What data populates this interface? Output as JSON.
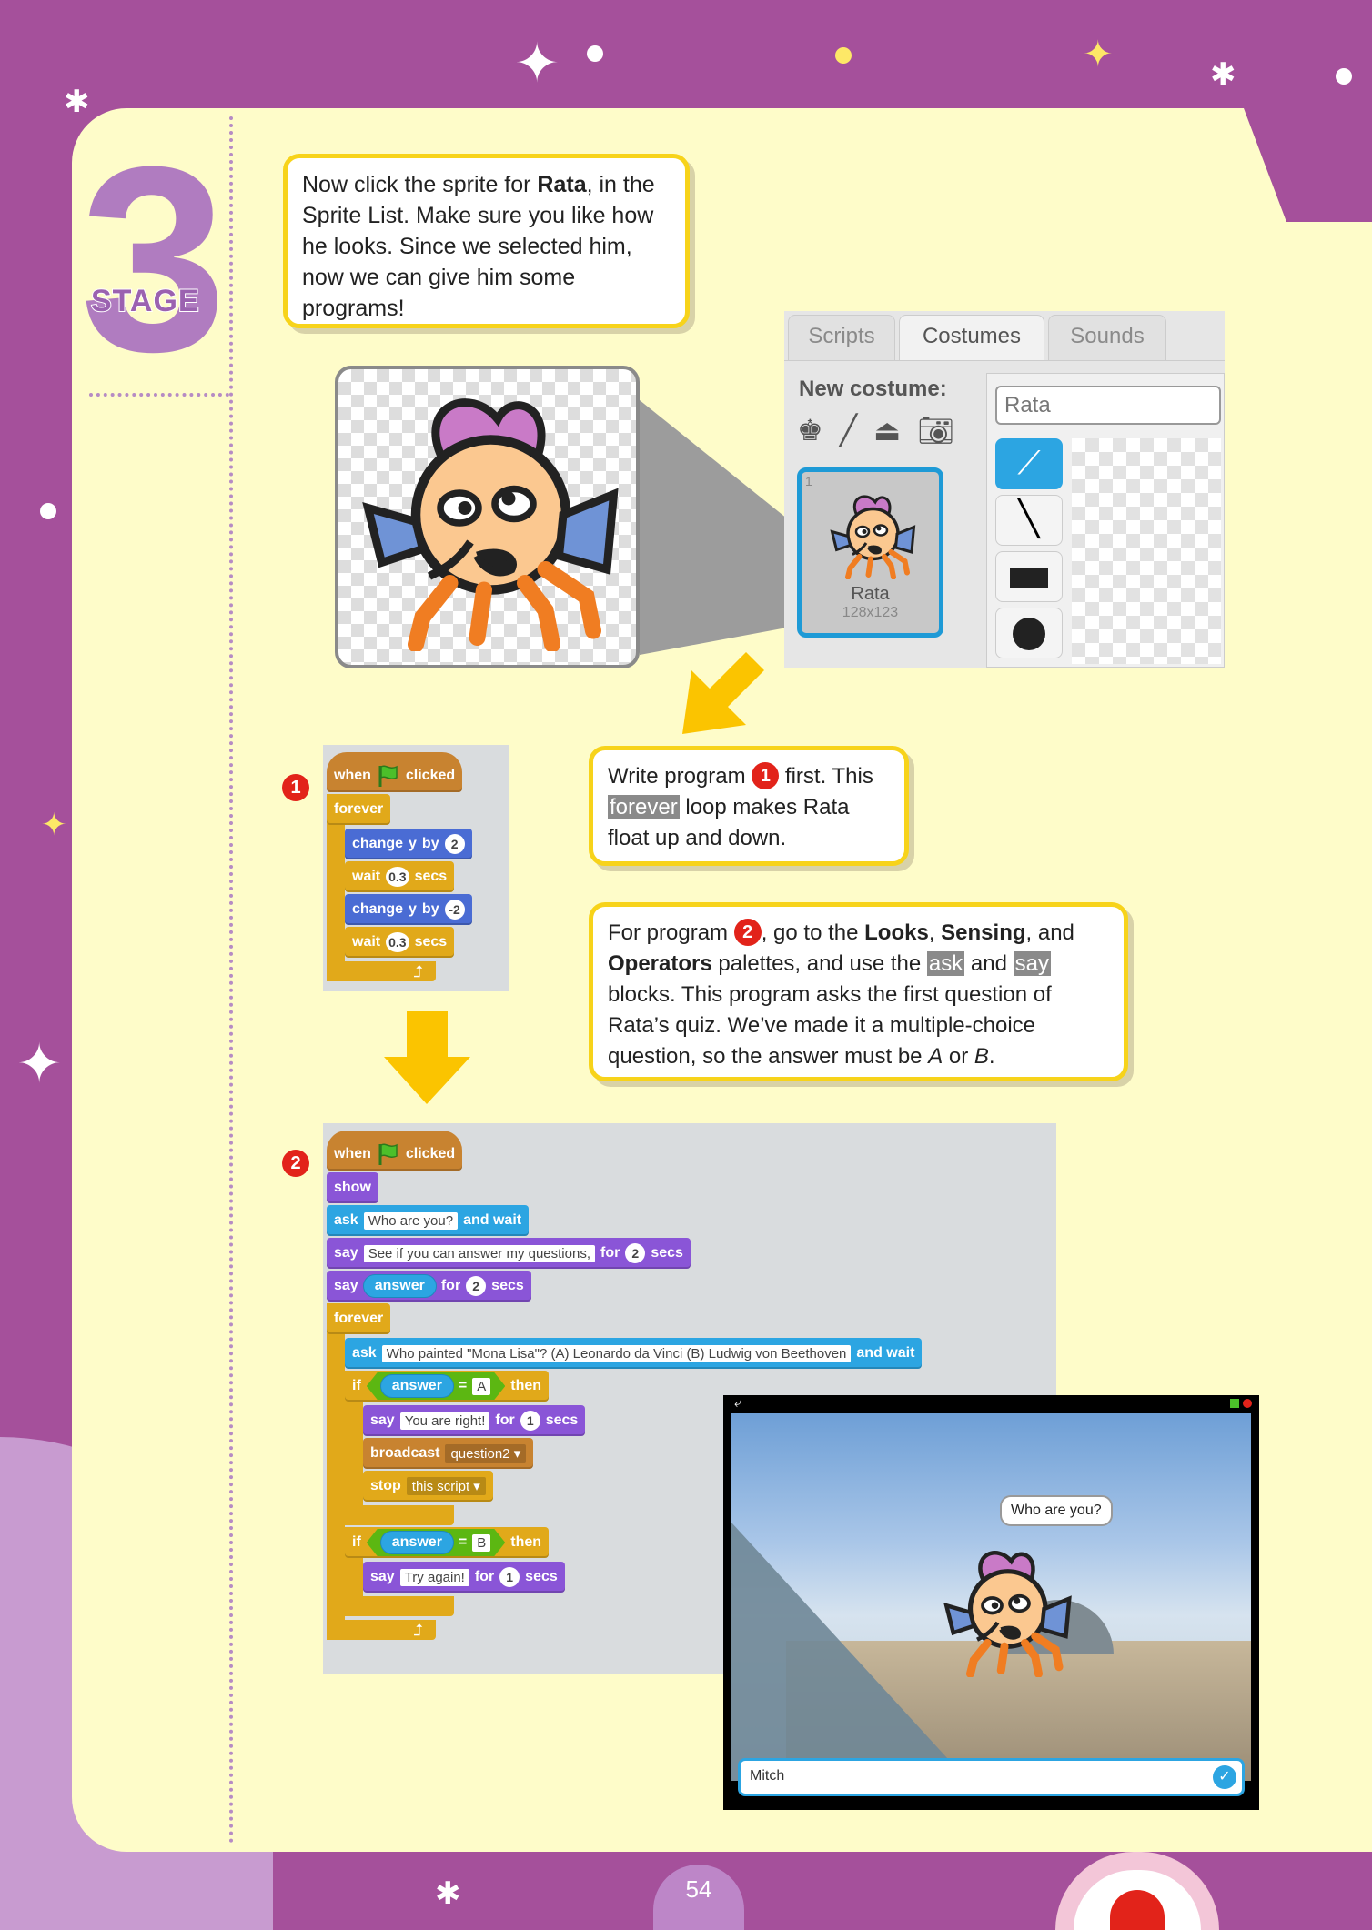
{
  "page": {
    "stage_number": "3",
    "stage_word": "STAGE",
    "page_number": "54"
  },
  "colors": {
    "page_bg": "#a5509b",
    "panel": "#fefcc9",
    "callout_border": "#f7d31a",
    "badge": "#e2231a",
    "events": "#c88330",
    "control": "#e1a91a",
    "motion": "#4a6cd4",
    "looks": "#8a55d7",
    "sensing": "#2ca5e2",
    "operators": "#5cb712"
  },
  "callout1": {
    "p1": "Now click the sprite for ",
    "b1": "Rata",
    "p2": ", in the Sprite List. Make sure you like how he looks. Since we selected him, now we can give him some programs!"
  },
  "callout2": {
    "p1": "Write program ",
    "badge": "1",
    "p2": " first. This ",
    "hl": "forever",
    "p3": " loop makes Rata float up and down."
  },
  "callout3": {
    "p1": "For program ",
    "badge": "2",
    "p2": ", go to the ",
    "b1": "Looks",
    "p3": ", ",
    "b2": "Sensing",
    "p4": ", and ",
    "b3": "Operators",
    "p5": " palettes, and use the ",
    "hl1": "ask",
    "p6": " and ",
    "hl2": "say",
    "p7": " blocks. This program asks the first question of Rata’s quiz. We’ve made it a multiple-choice question, so the answer must be ",
    "i1": "A",
    "p8": " or ",
    "i2": "B",
    "p9": "."
  },
  "costume_editor": {
    "tabs": [
      {
        "label": "Scripts"
      },
      {
        "label": "Costumes",
        "active": true
      },
      {
        "label": "Sounds"
      }
    ],
    "new_costume_label": "New costume:",
    "new_costume_icons": [
      "sprite-library-icon",
      "paint-brush-icon",
      "upload-icon",
      "camera-icon"
    ],
    "costume": {
      "index": "1",
      "name": "Rata",
      "size": "128x123"
    },
    "name_field": "Rata",
    "tools": [
      "brush-icon",
      "line-icon",
      "rectangle-icon",
      "ellipse-icon"
    ]
  },
  "program1": {
    "badge": "1",
    "blocks": [
      {
        "cat": "events",
        "hat": true,
        "parts": [
          {
            "k": "text",
            "v": "when"
          },
          {
            "k": "flag"
          },
          {
            "k": "text",
            "v": "clicked"
          }
        ]
      },
      {
        "cat": "control",
        "parts": [
          {
            "k": "text",
            "v": "forever"
          }
        ],
        "loop": true,
        "children": [
          {
            "cat": "motion",
            "parts": [
              {
                "k": "text",
                "v": "change"
              },
              {
                "k": "text",
                "v": "y"
              },
              {
                "k": "text",
                "v": "by"
              },
              {
                "k": "num",
                "v": "2"
              }
            ]
          },
          {
            "cat": "control",
            "parts": [
              {
                "k": "text",
                "v": "wait"
              },
              {
                "k": "num",
                "v": "0.3"
              },
              {
                "k": "text",
                "v": "secs"
              }
            ]
          },
          {
            "cat": "motion",
            "parts": [
              {
                "k": "text",
                "v": "change"
              },
              {
                "k": "text",
                "v": "y"
              },
              {
                "k": "text",
                "v": "by"
              },
              {
                "k": "num",
                "v": "-2"
              }
            ]
          },
          {
            "cat": "control",
            "parts": [
              {
                "k": "text",
                "v": "wait"
              },
              {
                "k": "num",
                "v": "0.3"
              },
              {
                "k": "text",
                "v": "secs"
              }
            ]
          }
        ]
      }
    ]
  },
  "program2": {
    "badge": "2",
    "blocks": [
      {
        "cat": "events",
        "hat": true,
        "parts": [
          {
            "k": "text",
            "v": "when"
          },
          {
            "k": "flag"
          },
          {
            "k": "text",
            "v": "clicked"
          }
        ]
      },
      {
        "cat": "looks",
        "parts": [
          {
            "k": "text",
            "v": "show"
          }
        ]
      },
      {
        "cat": "sensing",
        "parts": [
          {
            "k": "text",
            "v": "ask"
          },
          {
            "k": "inp",
            "v": "Who are you?"
          },
          {
            "k": "text",
            "v": "and wait"
          }
        ]
      },
      {
        "cat": "looks",
        "parts": [
          {
            "k": "text",
            "v": "say"
          },
          {
            "k": "inp",
            "v": "See if you can answer my questions,"
          },
          {
            "k": "text",
            "v": "for"
          },
          {
            "k": "num",
            "v": "2"
          },
          {
            "k": "text",
            "v": "secs"
          }
        ]
      },
      {
        "cat": "looks",
        "parts": [
          {
            "k": "text",
            "v": "say"
          },
          {
            "k": "rep",
            "v": "answer"
          },
          {
            "k": "text",
            "v": "for"
          },
          {
            "k": "num",
            "v": "2"
          },
          {
            "k": "text",
            "v": "secs"
          }
        ]
      },
      {
        "cat": "control",
        "parts": [
          {
            "k": "text",
            "v": "forever"
          }
        ],
        "loop": true,
        "children": [
          {
            "cat": "sensing",
            "parts": [
              {
                "k": "text",
                "v": "ask"
              },
              {
                "k": "inp",
                "v": "Who painted \"Mona Lisa\"? (A) Leonardo da Vinci (B) Ludwig von Beethoven"
              },
              {
                "k": "text",
                "v": "and wait"
              }
            ]
          },
          {
            "cat": "control",
            "parts": [
              {
                "k": "text",
                "v": "if"
              },
              {
                "k": "bool",
                "rep": "answer",
                "op": "=",
                "val": "A"
              },
              {
                "k": "text",
                "v": "then"
              }
            ],
            "children": [
              {
                "cat": "looks",
                "parts": [
                  {
                    "k": "text",
                    "v": "say"
                  },
                  {
                    "k": "inp",
                    "v": "You are right!"
                  },
                  {
                    "k": "text",
                    "v": "for"
                  },
                  {
                    "k": "num",
                    "v": "1"
                  },
                  {
                    "k": "text",
                    "v": "secs"
                  }
                ]
              },
              {
                "cat": "events",
                "parts": [
                  {
                    "k": "text",
                    "v": "broadcast"
                  },
                  {
                    "k": "dd",
                    "v": "question2"
                  }
                ]
              },
              {
                "cat": "control",
                "parts": [
                  {
                    "k": "text",
                    "v": "stop"
                  },
                  {
                    "k": "dd",
                    "v": "this script"
                  }
                ]
              }
            ]
          },
          {
            "cat": "control",
            "parts": [
              {
                "k": "text",
                "v": "if"
              },
              {
                "k": "bool",
                "rep": "answer",
                "op": "=",
                "val": "B"
              },
              {
                "k": "text",
                "v": "then"
              }
            ],
            "children": [
              {
                "cat": "looks",
                "parts": [
                  {
                    "k": "text",
                    "v": "say"
                  },
                  {
                    "k": "inp",
                    "v": "Try again!"
                  },
                  {
                    "k": "text",
                    "v": "for"
                  },
                  {
                    "k": "num",
                    "v": "1"
                  },
                  {
                    "k": "text",
                    "v": "secs"
                  }
                ]
              }
            ]
          }
        ]
      }
    ]
  },
  "stage": {
    "speech_bubble": "Who are you?",
    "answer_input": "Mitch"
  }
}
